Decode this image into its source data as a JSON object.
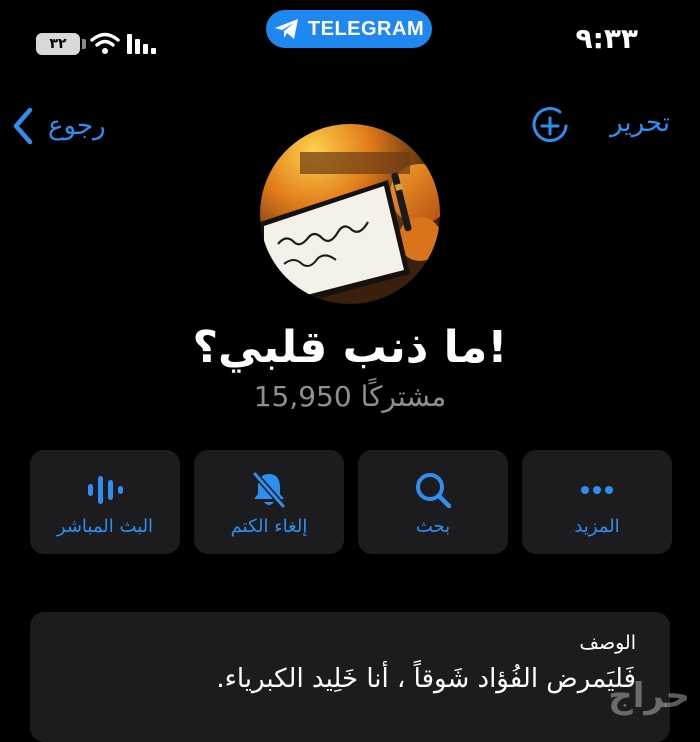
{
  "status_bar": {
    "time": "٩:٣٣",
    "battery": "٣٢",
    "app_pill": "TELEGRAM"
  },
  "nav": {
    "back_label": "رجوع",
    "edit_label": "تحرير"
  },
  "channel": {
    "title": "ما ذنب قلبي؟!",
    "subscribers": "15,950 مشتركًا"
  },
  "actions": [
    {
      "label": "المزيد",
      "icon": "more-icon"
    },
    {
      "label": "بحث",
      "icon": "search-icon"
    },
    {
      "label": "إلغاء الكتم",
      "icon": "muted-bell-icon"
    },
    {
      "label": "البث المباشر",
      "icon": "live-stream-icon"
    }
  ],
  "description": {
    "label": "الوصف",
    "text": "فَليَمرض الفُؤاد شَوقاً ، أنا خَلِيد الكبرياء."
  },
  "watermark": "حراج",
  "colors": {
    "accent": "#2f8ff0",
    "card": "#1c1c1e",
    "background": "#000000",
    "secondary_text": "#8e8e93",
    "telegram_pill": "#1f88f0"
  }
}
